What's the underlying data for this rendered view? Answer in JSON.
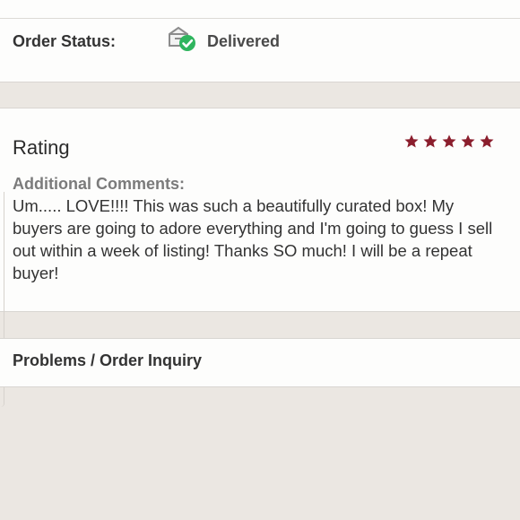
{
  "order": {
    "status_label": "Order Status:",
    "status_value": "Delivered",
    "status_icon": "package-delivered-icon"
  },
  "rating": {
    "title": "Rating",
    "stars": 5,
    "max_stars": 5,
    "star_color": "#8b1e2d"
  },
  "comments": {
    "label": "Additional Comments:",
    "text": "Um..... LOVE!!!! This was such a beautifully curated box! My buyers are going to adore everything and I'm going to guess I sell out within a week of listing! Thanks SO much! I will be a repeat buyer!"
  },
  "problems": {
    "label": "Problems / Order Inquiry"
  }
}
